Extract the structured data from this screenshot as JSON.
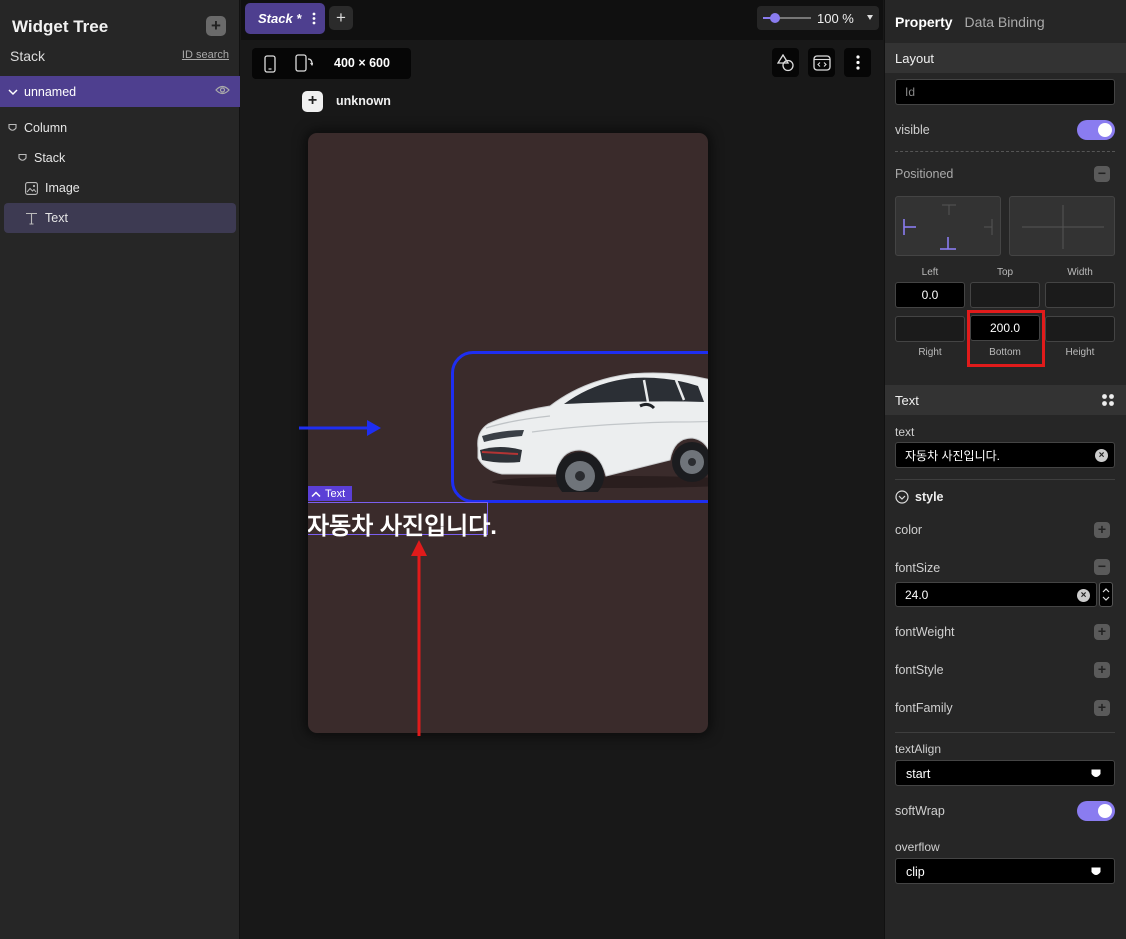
{
  "left_panel": {
    "title": "Widget Tree",
    "add_label": "+",
    "subtitle": "Stack",
    "id_search": "ID search",
    "root_node": "unnamed",
    "tree": [
      {
        "label": "Column"
      },
      {
        "label": "Stack"
      },
      {
        "label": "Image"
      },
      {
        "label": "Text"
      }
    ]
  },
  "center": {
    "tab_label": "Stack *",
    "tab_add": "+",
    "zoom": "100 %",
    "zoom_level": 0.25,
    "device_size": "400 × 600",
    "unknown_add": "+",
    "unknown_label": "unknown",
    "text_tag": "Text",
    "text_content": "자동차 사진입니다."
  },
  "right_panel": {
    "tab_property": "Property",
    "tab_data_binding": "Data Binding",
    "layout": {
      "header": "Layout",
      "id_placeholder": "Id",
      "visible_label": "visible",
      "positioned_label": "Positioned",
      "labels": {
        "left": "Left",
        "top": "Top",
        "width": "Width",
        "right": "Right",
        "bottom": "Bottom",
        "height": "Height"
      },
      "values": {
        "left": "0.0",
        "top": "",
        "width": "",
        "right": "",
        "bottom": "200.0",
        "height": ""
      }
    },
    "text": {
      "header": "Text",
      "text_label": "text",
      "text_value": "자동차 사진입니다.",
      "style_label": "style",
      "color_label": "color",
      "font_size_label": "fontSize",
      "font_size_value": "24.0",
      "font_weight_label": "fontWeight",
      "font_style_label": "fontStyle",
      "font_family_label": "fontFamily",
      "text_align_label": "textAlign",
      "text_align_value": "start",
      "soft_wrap_label": "softWrap",
      "overflow_label": "overflow",
      "overflow_value": "clip"
    }
  },
  "colors": {
    "accent": "#8a7cf0",
    "selection": "#4e3f8f",
    "highlight_blue": "#1e2ef2",
    "highlight_red": "#e01b1b"
  }
}
